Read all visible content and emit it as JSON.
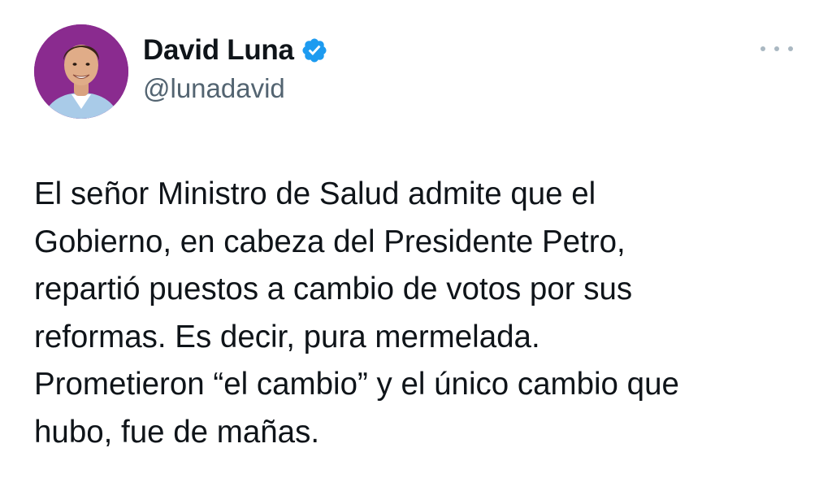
{
  "author": {
    "display_name": "David Luna",
    "handle": "@lunadavid",
    "verified": true,
    "verified_color": "#1d9bf0",
    "avatar_bg_color": "#8a2b8f"
  },
  "tweet": {
    "lines": [
      "El señor Ministro de Salud admite que el",
      "Gobierno, en cabeza del Presidente Petro,",
      "repartió puestos a cambio de votos por sus",
      "reformas. Es decir, pura mermelada.",
      "Prometieron “el cambio” y el único cambio que",
      "hubo, fue de mañas."
    ]
  },
  "icons": {
    "more": "more-horizontal-icon",
    "verified": "verified-badge-icon"
  }
}
